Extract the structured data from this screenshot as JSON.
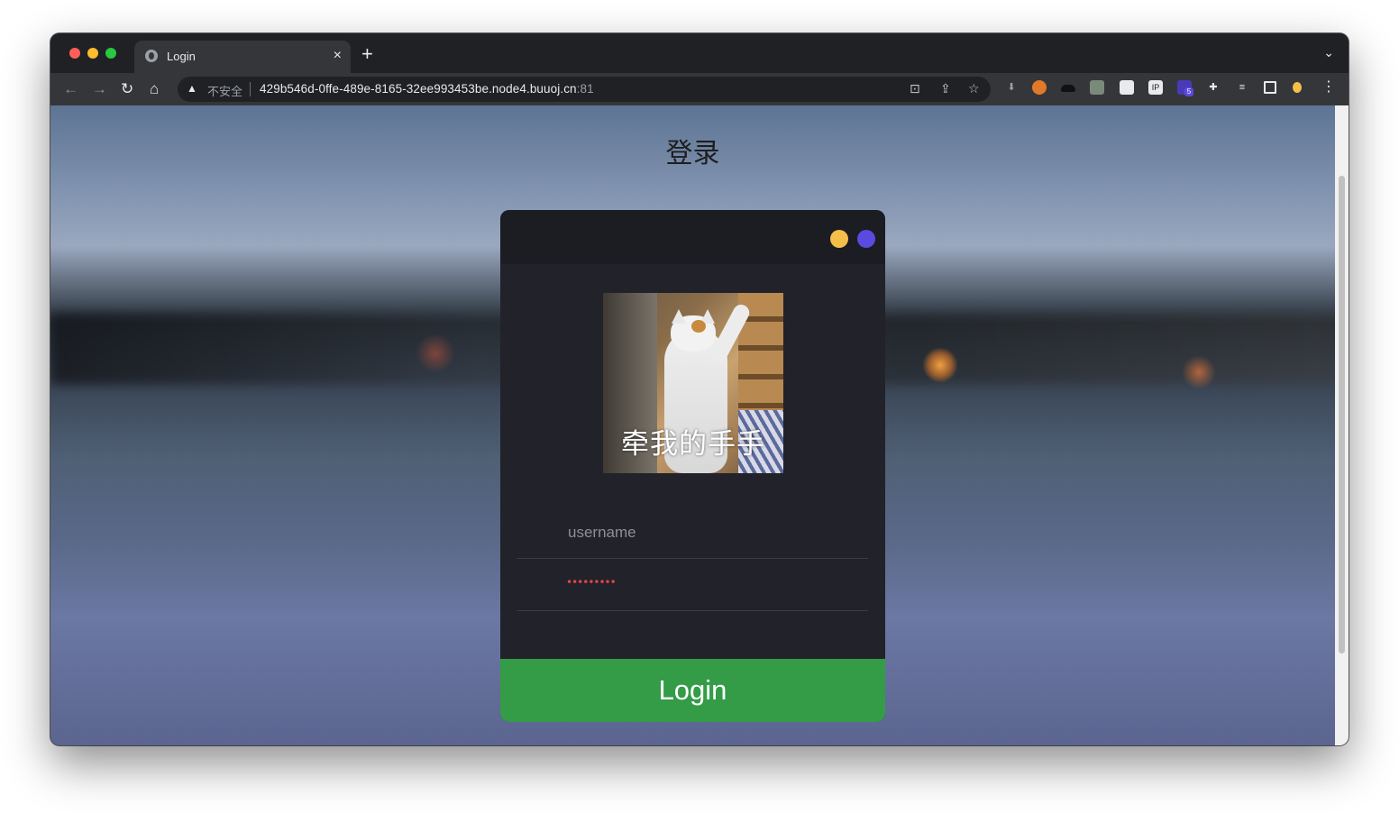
{
  "browser": {
    "tab_title": "Login",
    "tab_close": "×",
    "new_tab": "+",
    "tab_menu": "⌄",
    "security_label": "不安全",
    "url_host": "429b546d-0ffe-489e-8165-32ee993453be.node4.buuoj.cn",
    "url_port": ":81",
    "extension_badge": "5"
  },
  "page": {
    "heading": "登录"
  },
  "login_card": {
    "avatar_caption": "牵我的手手",
    "username_placeholder": "username",
    "password_masked": "•••••••••",
    "login_label": "Login"
  },
  "colors": {
    "card_bg": "#22222b",
    "login_button": "#349c47",
    "dot_yellow": "#f5be4a",
    "dot_purple": "#5a4ae0"
  }
}
